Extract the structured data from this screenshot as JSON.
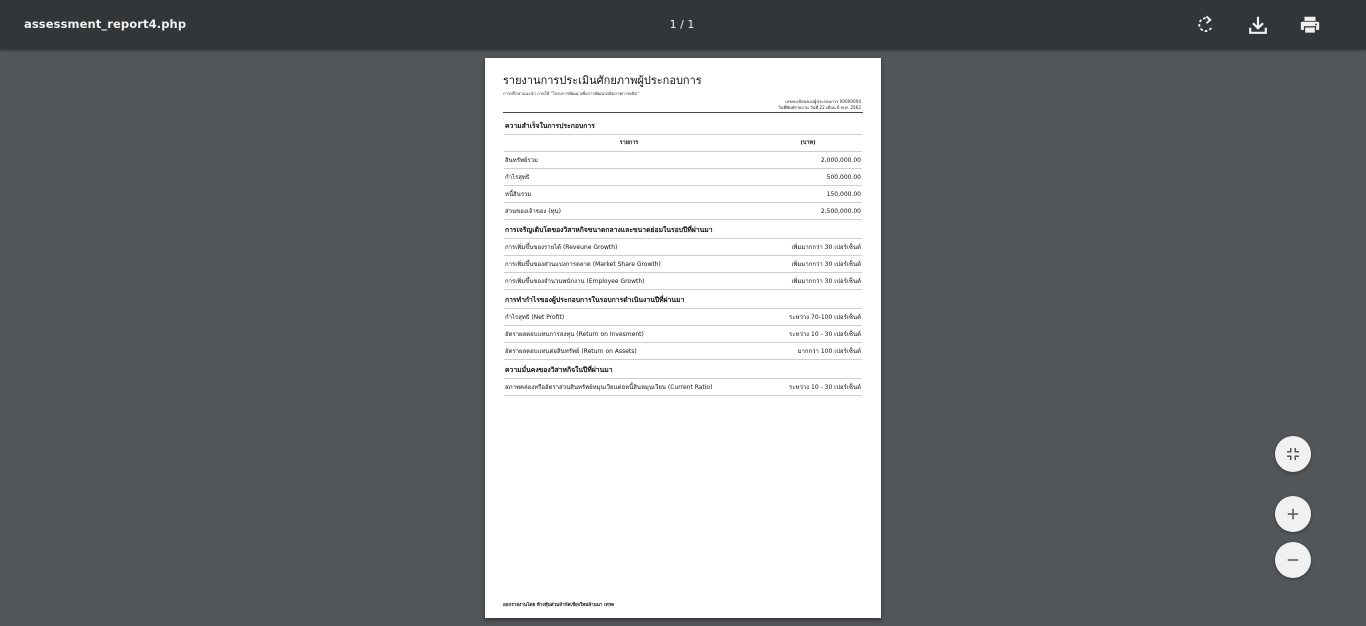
{
  "toolbar": {
    "filename": "assessment_report4.php",
    "page_indicator": "1 / 1",
    "rotate_icon": "rotate-icon",
    "download_icon": "download-icon",
    "print_icon": "print-icon"
  },
  "document": {
    "title": "รายงานการประเมินศักยภาพผู้ประกอบการ",
    "subtitle": "การปรึกษาแนะนำ ภายใต้ \"โครงการพัฒนาเพื่อการพัฒนาผลิตภาพการผลิต\"",
    "meta_line1": "เลขทะเบียนของผู้ประกอบการ 00000004",
    "meta_line2": "วันที่พิมพ์รายงาน วันที่ 22 เดือน 6 พ.ศ. 2562",
    "section1_title": "ความสำเร็จในการประกอบการ",
    "col_item": "รายการ",
    "col_unit": "(บาท)",
    "financials": [
      {
        "label": "สินทรัพย์รวม",
        "value": "2,000,000.00"
      },
      {
        "label": "กำไรสุทธิ",
        "value": "500,000.00"
      },
      {
        "label": "หนี้สินรวม",
        "value": "150,000.00"
      },
      {
        "label": "ส่วนของเจ้าของ (ทุน)",
        "value": "2,500,000.00"
      }
    ],
    "section2_title": "การเจริญเติบโตของวิสาหกิจขนาดกลางและขนาดย่อมในรอบปีที่ผ่านมา",
    "growth": [
      {
        "label": "การเพิ่มขึ้นของรายได้ (Reveune Growth)",
        "value": "เพิ่มมากกว่า 30 เปอร์เซ็นต์"
      },
      {
        "label": "การเพิ่มขึ้นของส่วนแบ่งการตลาด (Market Share Growth)",
        "value": "เพิ่มมากกว่า 30 เปอร์เซ็นต์"
      },
      {
        "label": "การเพิ่มขึ้นของจำนวนพนักงาน (Employee Growth)",
        "value": "เพิ่มมากกว่า 30 เปอร์เซ็นต์"
      }
    ],
    "section3_title": "การทำกำไรของผู้ประกอบการในรอบการดำเนินงานปีที่ผ่านมา",
    "profit": [
      {
        "label": "กำไรสุทธิ (Net Profit)",
        "value": "ระหว่าง 70-100 เปอร์เซ็นต์"
      },
      {
        "label": "อัตราผลตอบแทนการลงทุน (Return on Invesment)",
        "value": "ระหว่าง 10 - 30 เปอร์เซ็นต์"
      },
      {
        "label": "อัตราผลตอบแทนต่อสินทรัพย์ (Return on Assets)",
        "value": "มากกว่า 100 เปอร์เซ็นต์"
      }
    ],
    "section4_title": "ความมั่นคงของวิสาหกิจในปีที่ผ่านมา",
    "stability": [
      {
        "label": "สภาพคล่องหรืออัตราส่วนสินทรัพย์หมุนเวียนต่อหนี้สินหมุนเวียน (Current Ratio)",
        "value": "ระหว่าง 10 - 30 เปอร์เซ็นต์"
      }
    ],
    "footer": "ออกรายงานโดย ห้างหุ้นส่วนจำกัดเชียงใหม่ล้านนา เทรด"
  },
  "controls": {
    "fit_icon": "fit-page-icon",
    "zoom_in_icon": "zoom-in-icon",
    "zoom_out_icon": "zoom-out-icon"
  },
  "colors": {
    "toolbar_bg": "#323639",
    "viewer_bg": "#525659",
    "page_bg": "#ffffff"
  }
}
